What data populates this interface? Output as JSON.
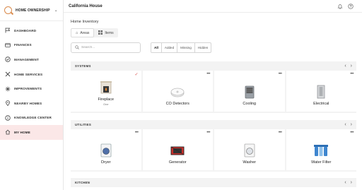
{
  "sidebar": {
    "brand_label": "HOME OWNERSHIP",
    "items": [
      {
        "label": "DASHBOARD",
        "icon": "flag-icon"
      },
      {
        "label": "FINANCES",
        "icon": "card-icon"
      },
      {
        "label": "MANAGEMENT",
        "icon": "check-circle-icon"
      },
      {
        "label": "HOME SERVICES",
        "icon": "tools-icon"
      },
      {
        "label": "IMPROVEMENTS",
        "icon": "spark-icon"
      },
      {
        "label": "NEARBY HOMES",
        "icon": "map-pin-icon"
      },
      {
        "label": "KNOWLEDGE CENTER",
        "icon": "info-icon"
      },
      {
        "label": "MY HOME",
        "icon": "house-icon"
      }
    ]
  },
  "topbar": {
    "title": "California House"
  },
  "main": {
    "heading": "Home Inventory",
    "tabs": [
      {
        "label": "Areas"
      },
      {
        "label": "Items"
      }
    ],
    "search": {
      "placeholder": "Search..."
    },
    "filters": [
      {
        "label": "All"
      },
      {
        "label": "Added"
      },
      {
        "label": "Missing"
      },
      {
        "label": "Hidden"
      }
    ]
  },
  "sections": [
    {
      "title": "SYSTEMS",
      "cards": [
        {
          "name": "Fireplace",
          "sub": "One",
          "icon": "fireplace-icon"
        },
        {
          "name": "CO Detectors",
          "icon": "co-detector-icon"
        },
        {
          "name": "Cooling",
          "icon": "ac-unit-icon"
        },
        {
          "name": "Electrical",
          "icon": "electrical-panel-icon"
        }
      ]
    },
    {
      "title": "UTILITIES",
      "cards": [
        {
          "name": "Dryer",
          "icon": "dryer-icon"
        },
        {
          "name": "Generator",
          "icon": "generator-icon"
        },
        {
          "name": "Washer",
          "icon": "washer-icon"
        },
        {
          "name": "Water Filter",
          "icon": "water-filter-icon"
        }
      ]
    },
    {
      "title": "KITCHEN"
    }
  ],
  "colors": {
    "accent": "#d98a4a",
    "active_nav_bg": "#fbe7e7",
    "check": "#d9534f"
  }
}
